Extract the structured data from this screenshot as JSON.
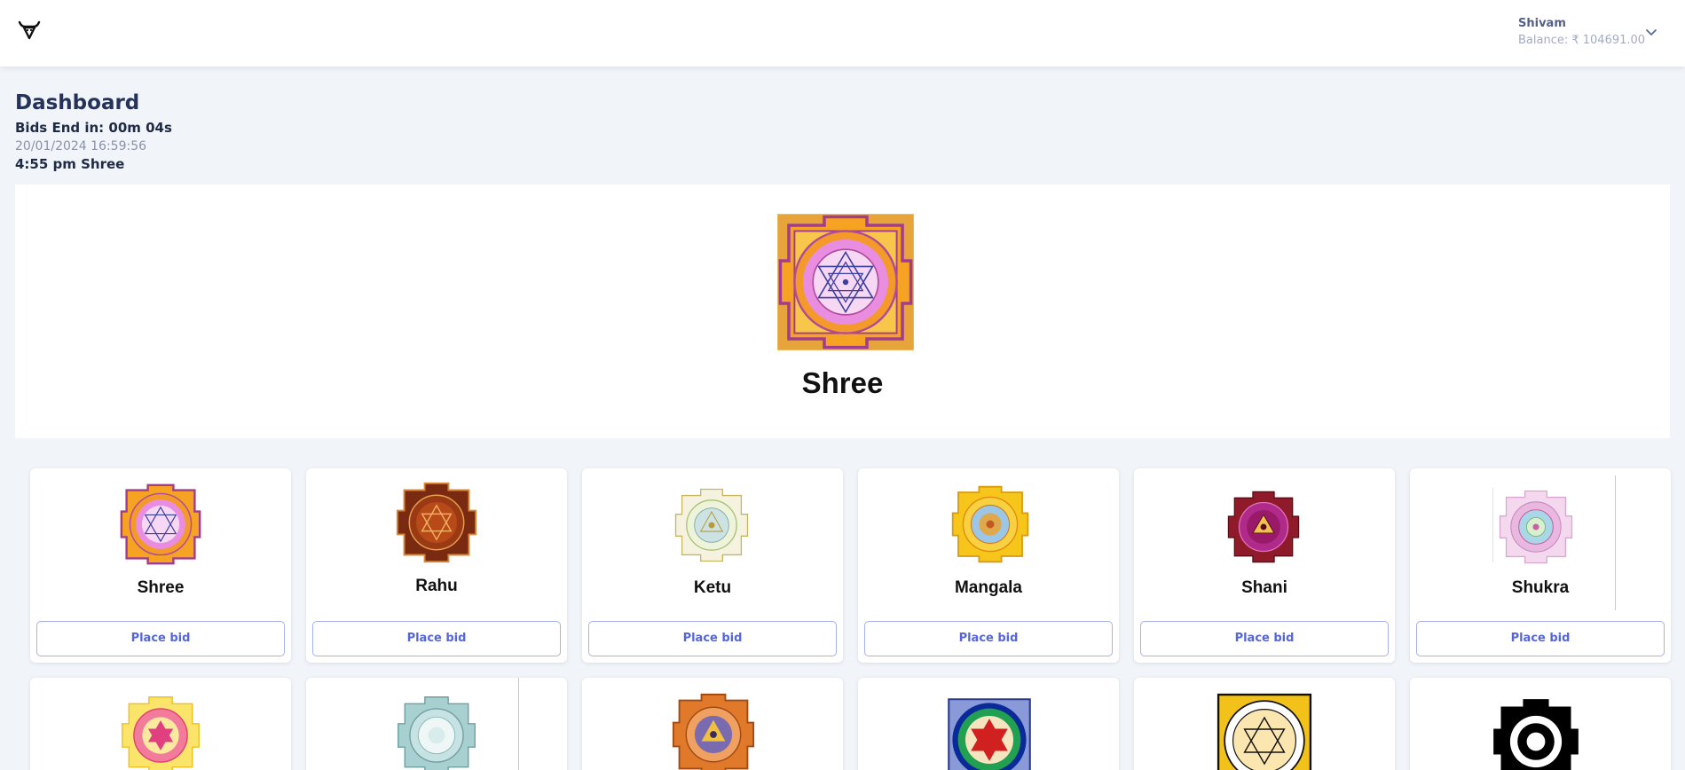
{
  "header": {
    "user_name": "Shivam",
    "balance": "Balance: ₹ 104691.00"
  },
  "dashboard": {
    "title": "Dashboard",
    "bids_end": "Bids End in: 00m 04s",
    "datetime": "20/01/2024 16:59:56",
    "last_result": "4:55 pm Shree"
  },
  "hero": {
    "name": "Shree"
  },
  "cards": [
    {
      "name": "Shree",
      "button": "Place bid"
    },
    {
      "name": "Rahu",
      "button": "Place bid"
    },
    {
      "name": "Ketu",
      "button": "Place bid"
    },
    {
      "name": "Mangala",
      "button": "Place bid"
    },
    {
      "name": "Shani",
      "button": "Place bid"
    },
    {
      "name": "Shukra",
      "button": "Place bid"
    }
  ],
  "colors": {
    "accent": "#5566d8",
    "background": "#f1f4f9",
    "heading": "#25325a"
  }
}
